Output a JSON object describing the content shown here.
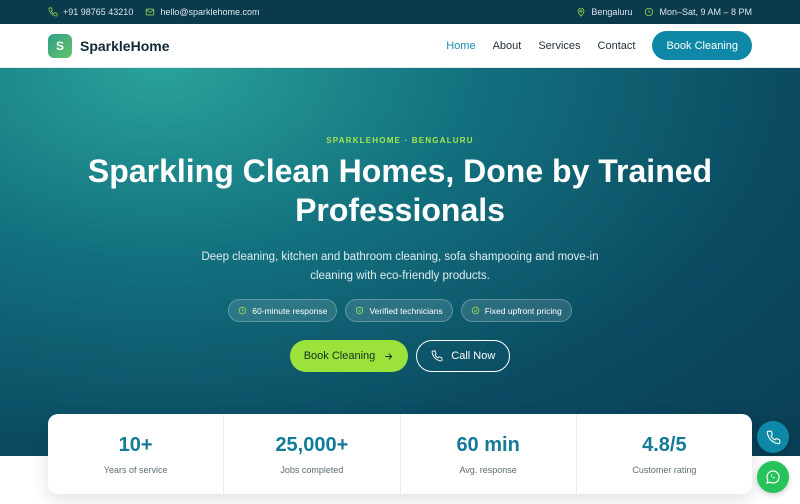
{
  "topbar": {
    "phone": "+91 98765 43210",
    "email": "hello@sparklehome.com",
    "location": "Bengaluru",
    "hours": "Mon–Sat, 9 AM – 8 PM"
  },
  "nav": {
    "logo_letter": "S",
    "brand": "SparkleHome",
    "links": [
      {
        "label": "Home",
        "active": true
      },
      {
        "label": "About",
        "active": false
      },
      {
        "label": "Services",
        "active": false
      },
      {
        "label": "Contact",
        "active": false
      }
    ],
    "cta": "Book Cleaning"
  },
  "hero": {
    "eyebrow": "SPARKLEHOME · BENGALURU",
    "title": "Sparkling Clean Homes, Done by Trained Professionals",
    "description": "Deep cleaning, kitchen and bathroom cleaning, sofa shampooing and move-in cleaning with eco-friendly products.",
    "pills": [
      {
        "label": "60-minute response",
        "icon": "clock-icon"
      },
      {
        "label": "Verified technicians",
        "icon": "shield-icon"
      },
      {
        "label": "Fixed upfront pricing",
        "icon": "check-circle-icon"
      }
    ],
    "primary_cta": "Book Cleaning",
    "secondary_cta": "Call Now"
  },
  "stats": [
    {
      "value": "10+",
      "label": "Years of service"
    },
    {
      "value": "25,000+",
      "label": "Jobs completed"
    },
    {
      "value": "60 min",
      "label": "Avg. response"
    },
    {
      "value": "4.8/5",
      "label": "Customer rating"
    }
  ],
  "colors": {
    "accent": "#0e88a6",
    "lime": "#9be33a",
    "topbar": "#0b3a4c",
    "whatsapp": "#25c35a"
  }
}
